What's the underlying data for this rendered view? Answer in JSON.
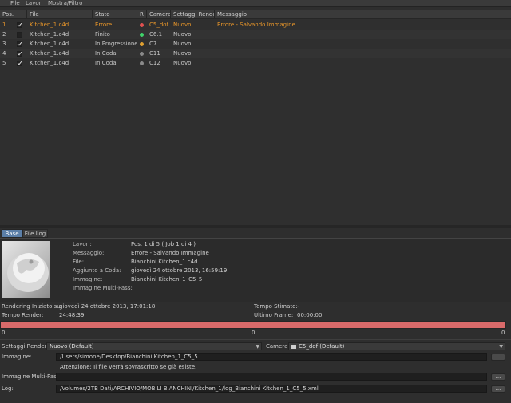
{
  "menu": {
    "items": [
      "File",
      "Lavori",
      "Mostra/Filtro"
    ]
  },
  "table": {
    "headers": {
      "pos": "Pos.",
      "file": "File",
      "stato": "Stato",
      "r": "R",
      "camera": "Camera",
      "settaggi": "Settaggi Render",
      "messaggio": "Messaggio"
    },
    "rows": [
      {
        "pos": "1",
        "checked": true,
        "file": "Kitchen_1.c4d",
        "stato": "Errore",
        "dot": "#e05050",
        "camera": "C5_dof",
        "settaggi": "Nuovo",
        "messaggio": "Errore - Salvando Immagine",
        "error": true
      },
      {
        "pos": "2",
        "checked": false,
        "file": "Kitchen_1.c4d",
        "stato": "Finito",
        "dot": "#3fd36a",
        "camera": "C6.1",
        "settaggi": "Nuovo",
        "messaggio": "",
        "error": false
      },
      {
        "pos": "3",
        "checked": true,
        "file": "Kitchen_1.c4d",
        "stato": "In Progressione",
        "dot": "#e0a030",
        "camera": "C7",
        "settaggi": "Nuovo",
        "messaggio": "",
        "error": false
      },
      {
        "pos": "4",
        "checked": true,
        "file": "Kitchen_1.c4d",
        "stato": "In Coda",
        "dot": "#8a8a8a",
        "camera": "C11",
        "settaggi": "Nuovo",
        "messaggio": "",
        "error": false
      },
      {
        "pos": "5",
        "checked": true,
        "file": "Kitchen_1.c4d",
        "stato": "In Coda",
        "dot": "#8a8a8a",
        "camera": "C12",
        "settaggi": "Nuovo",
        "messaggio": "",
        "error": false
      }
    ]
  },
  "tabs": {
    "base": "Base",
    "file_log": "File Log"
  },
  "info": {
    "lavori_label": "Lavori:",
    "lavori_value": "Pos. 1 di 5 ( Job 1 di 4 )",
    "messaggio_label": "Messaggio:",
    "messaggio_value": "Errore - Salvando Immagine",
    "file_label": "File:",
    "file_value": "Bianchini Kitchen_1.c4d",
    "aggiunto_label": "Aggiunto a Coda:",
    "aggiunto_value": "giovedì 24 ottobre 2013, 16:59:19",
    "immagine_label": "Immagine:",
    "immagine_value": "Bianchini Kitchen_1_C5_5",
    "multipass_label": "Immagine Multi-Pass:",
    "multipass_value": ""
  },
  "stats": {
    "rendering_label": "Rendering Iniziato su:",
    "rendering_value": "giovedì 24 ottobre 2013, 17:01:18",
    "tempo_stimato_label": "Tempo Stimato:",
    "tempo_stimato_value": "-",
    "tempo_render_label": "Tempo Render:",
    "tempo_render_value": "24:48:39",
    "ultimo_frame_label": "Ultimo Frame:",
    "ultimo_frame_value": "00:00:00"
  },
  "progress": {
    "fraction": 1.0,
    "ticks": [
      "0",
      "0",
      "0"
    ],
    "color": "#d96a6a"
  },
  "settings": {
    "settaggi_label": "Settaggi Render:",
    "settaggi_value": "Nuovo (Default)",
    "camera_label": "Camera",
    "camera_value": "C5_dof (Default)",
    "immagine_label": "Immagine:",
    "immagine_path": "/Users/simone/Desktop/Bianchini Kitchen_1_C5_5",
    "warning": "Attenzione: Il file verrà sovrascritto se già esiste.",
    "multipass_label": "Immagine Multi-Pass:",
    "multipass_path": "",
    "log_label": "Log:",
    "log_path": "/Volumes/2TB Dati/ARCHIVIO/MOBILI BIANCHINI/Kitchen_1/log_Bianchini Kitchen_1_C5_5.xml",
    "browse": "..."
  },
  "colors": {
    "error_text": "#e8962a",
    "tab_active": "#5b7fa8"
  }
}
